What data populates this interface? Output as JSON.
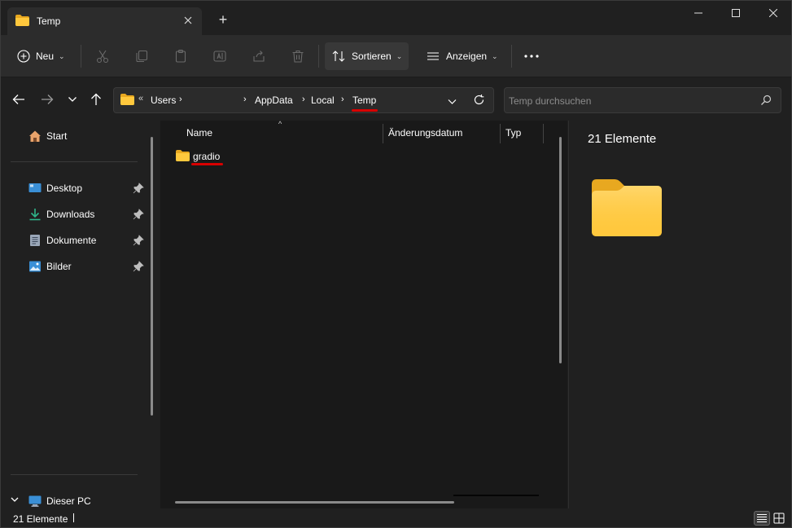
{
  "window": {
    "tab_title": "Temp",
    "new_tab_label": "+"
  },
  "toolbar": {
    "new_label": "Neu",
    "sort_label": "Sortieren",
    "view_label": "Anzeigen",
    "more_label": "•••"
  },
  "address": {
    "overflow": "«",
    "crumbs": [
      "Users",
      "AppData",
      "Local",
      "Temp"
    ],
    "sep": "›"
  },
  "search": {
    "placeholder": "Temp durchsuchen"
  },
  "sidebar": {
    "items": [
      {
        "label": "Start",
        "icon": "home-icon",
        "pinned": false
      },
      {
        "label": "Desktop",
        "icon": "desktop-icon",
        "pinned": true
      },
      {
        "label": "Downloads",
        "icon": "download-icon",
        "pinned": true
      },
      {
        "label": "Dokumente",
        "icon": "document-icon",
        "pinned": true
      },
      {
        "label": "Bilder",
        "icon": "pictures-icon",
        "pinned": true
      }
    ],
    "this_pc_label": "Dieser PC"
  },
  "file_list": {
    "columns": [
      "Name",
      "Änderungsdatum",
      "Typ"
    ],
    "rows": [
      {
        "name": "gradio",
        "type": "folder"
      }
    ]
  },
  "details": {
    "count_label": "21 Elemente"
  },
  "status": {
    "count_label": "21 Elemente"
  },
  "colors": {
    "background": "#202020",
    "pane": "#191919",
    "toolbar": "#2c2c2c",
    "folder": "#ffc83d",
    "annotation": "#d80000"
  }
}
